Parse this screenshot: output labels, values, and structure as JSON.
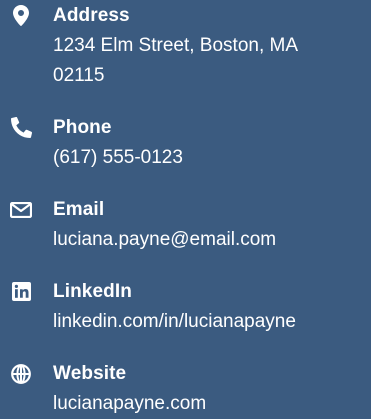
{
  "contacts": [
    {
      "icon": "map-marker-icon",
      "label": "Address",
      "value": "1234 Elm Street, Boston, MA 02115"
    },
    {
      "icon": "phone-icon",
      "label": "Phone",
      "value": "(617) 555-0123"
    },
    {
      "icon": "envelope-icon",
      "label": "Email",
      "value": "luciana.payne@email.com"
    },
    {
      "icon": "linkedin-icon",
      "label": "LinkedIn",
      "value": "linkedin.com/in/lucianapayne"
    },
    {
      "icon": "globe-icon",
      "label": "Website",
      "value": "lucianapayne.com"
    }
  ],
  "colors": {
    "background": "#3b5b80",
    "text": "#ffffff"
  }
}
